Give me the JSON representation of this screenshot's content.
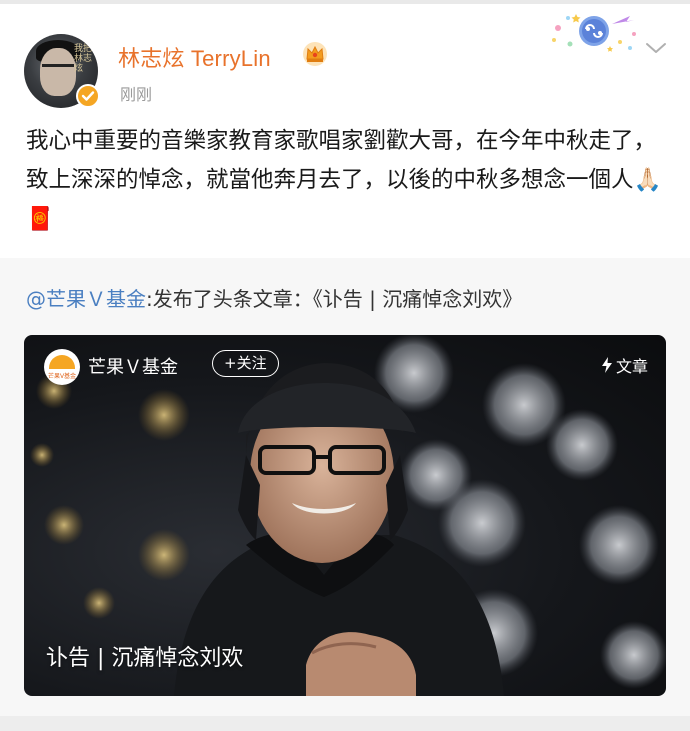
{
  "post": {
    "username": "林志炫 TerryLin",
    "timestamp": "刚刚",
    "avatar_script": "我把\n林志\n炫",
    "content": "我心中重要的音樂家教育家歌唱家劉歡大哥，在今年中秋走了，致上深深的悼念，就當他奔月去了，以後的中秋多想念一個人🙏🏻🧧",
    "icons": {
      "verified": "verified-badge-icon",
      "crown": "vip-crown-icon",
      "zodiac": "cancer-zodiac-badge-icon",
      "menu": "chevron-down-icon"
    }
  },
  "repost": {
    "mention": "@芒果Ｖ基金",
    "text": ":发布了头条文章：《讣告 | 沉痛悼念刘欢》",
    "card": {
      "logo_text": "芒果V基金",
      "account_name": "芒果Ｖ基金",
      "follow_label": "+关注",
      "article_label": "文章",
      "title": "讣告 | 沉痛悼念刘欢"
    }
  },
  "colors": {
    "username": "#e8722b",
    "mention": "#4a7fc1",
    "verified": "#f5a623",
    "timestamp": "#9a9a9a"
  }
}
